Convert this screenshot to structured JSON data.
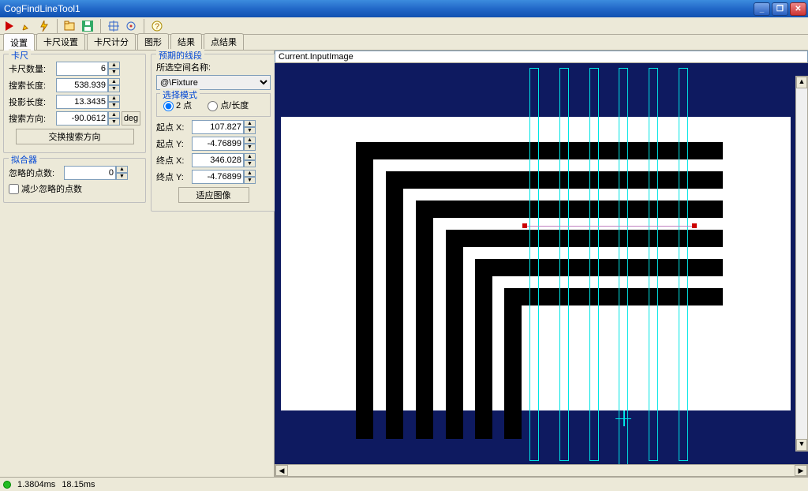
{
  "window": {
    "title": "CogFindLineTool1"
  },
  "tabs": [
    "设置",
    "卡尺设置",
    "卡尺计分",
    "图形",
    "结果",
    "点结果"
  ],
  "caliper": {
    "title": "卡尺",
    "count_label": "卡尺数量:",
    "count": "6",
    "searchlen_label": "搜索长度:",
    "searchlen": "538.939",
    "projlen_label": "投影长度:",
    "projlen": "13.3435",
    "dir_label": "搜索方向:",
    "dir": "-90.0612",
    "deg": "deg",
    "swap_btn": "交换搜索方向"
  },
  "expect": {
    "title": "预期的线段",
    "space_label": "所选空间名称:",
    "space_value": "@\\Fixture",
    "mode_title": "选择模式",
    "mode_2pt": "2 点",
    "mode_ptlen": "点/长度",
    "startx_label": "起点 X:",
    "startx": "107.827",
    "starty_label": "起点 Y:",
    "starty": "-4.76899",
    "endx_label": "终点 X:",
    "endx": "346.028",
    "endy_label": "终点 Y:",
    "endy": "-4.76899",
    "fit_btn": "适应图像"
  },
  "fit": {
    "title": "拟合器",
    "ignore_label": "忽略的点数:",
    "ignore_val": "0",
    "reduce_label": "减少忽略的点数"
  },
  "image_label": "Current.InputImage",
  "status": {
    "t1": "1.3804ms",
    "t2": "18.15ms"
  }
}
